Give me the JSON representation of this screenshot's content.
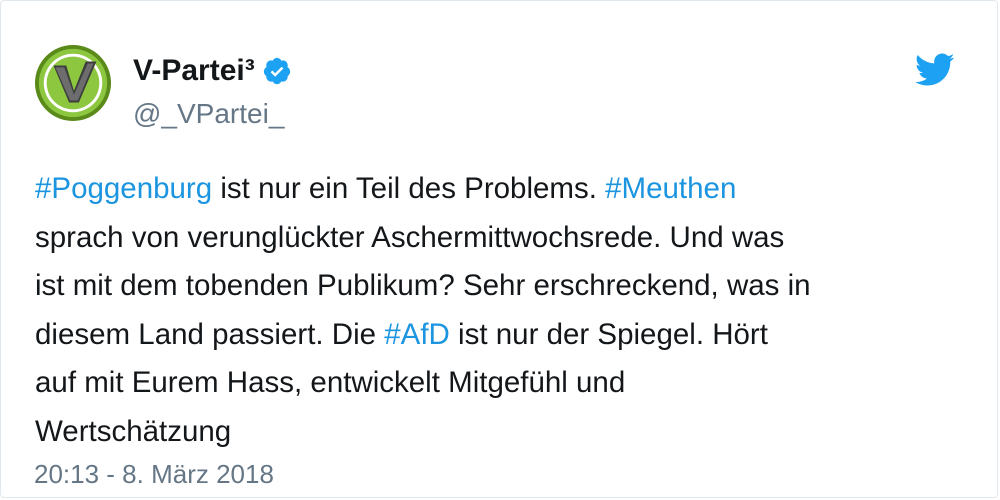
{
  "author": {
    "display_name": "V-Partei³",
    "handle": "@_VPartei_",
    "avatar_icon": "v-partei-logo-icon",
    "verified_icon": "verified-badge-icon"
  },
  "brand": {
    "icon": "twitter-bird-icon",
    "color": "#1da1f2"
  },
  "tweet": {
    "lines": [
      [
        {
          "text": "#Poggenburg",
          "hashtag": true
        },
        {
          "text": " ist nur ein Teil des Problems. ",
          "hashtag": false
        },
        {
          "text": "#Meuthen",
          "hashtag": true
        }
      ],
      [
        {
          "text": "sprach von verunglückter Aschermittwochsrede. Und was",
          "hashtag": false
        }
      ],
      [
        {
          "text": "ist mit dem tobenden Publikum? Sehr erschreckend, was in",
          "hashtag": false
        }
      ],
      [
        {
          "text": "diesem Land passiert. Die ",
          "hashtag": false
        },
        {
          "text": "#AfD",
          "hashtag": true
        },
        {
          "text": " ist nur der Spiegel. Hört",
          "hashtag": false
        }
      ],
      [
        {
          "text": "auf mit Eurem Hass,  entwickelt Mitgefühl und",
          "hashtag": false
        }
      ],
      [
        {
          "text": "Wertschätzung",
          "hashtag": false
        }
      ]
    ],
    "timestamp": "20:13 - 8. März 2018"
  },
  "colors": {
    "text": "#14171a",
    "muted": "#657786",
    "hashtag": "#1b95e0",
    "logo_green": "#8dc63f"
  }
}
